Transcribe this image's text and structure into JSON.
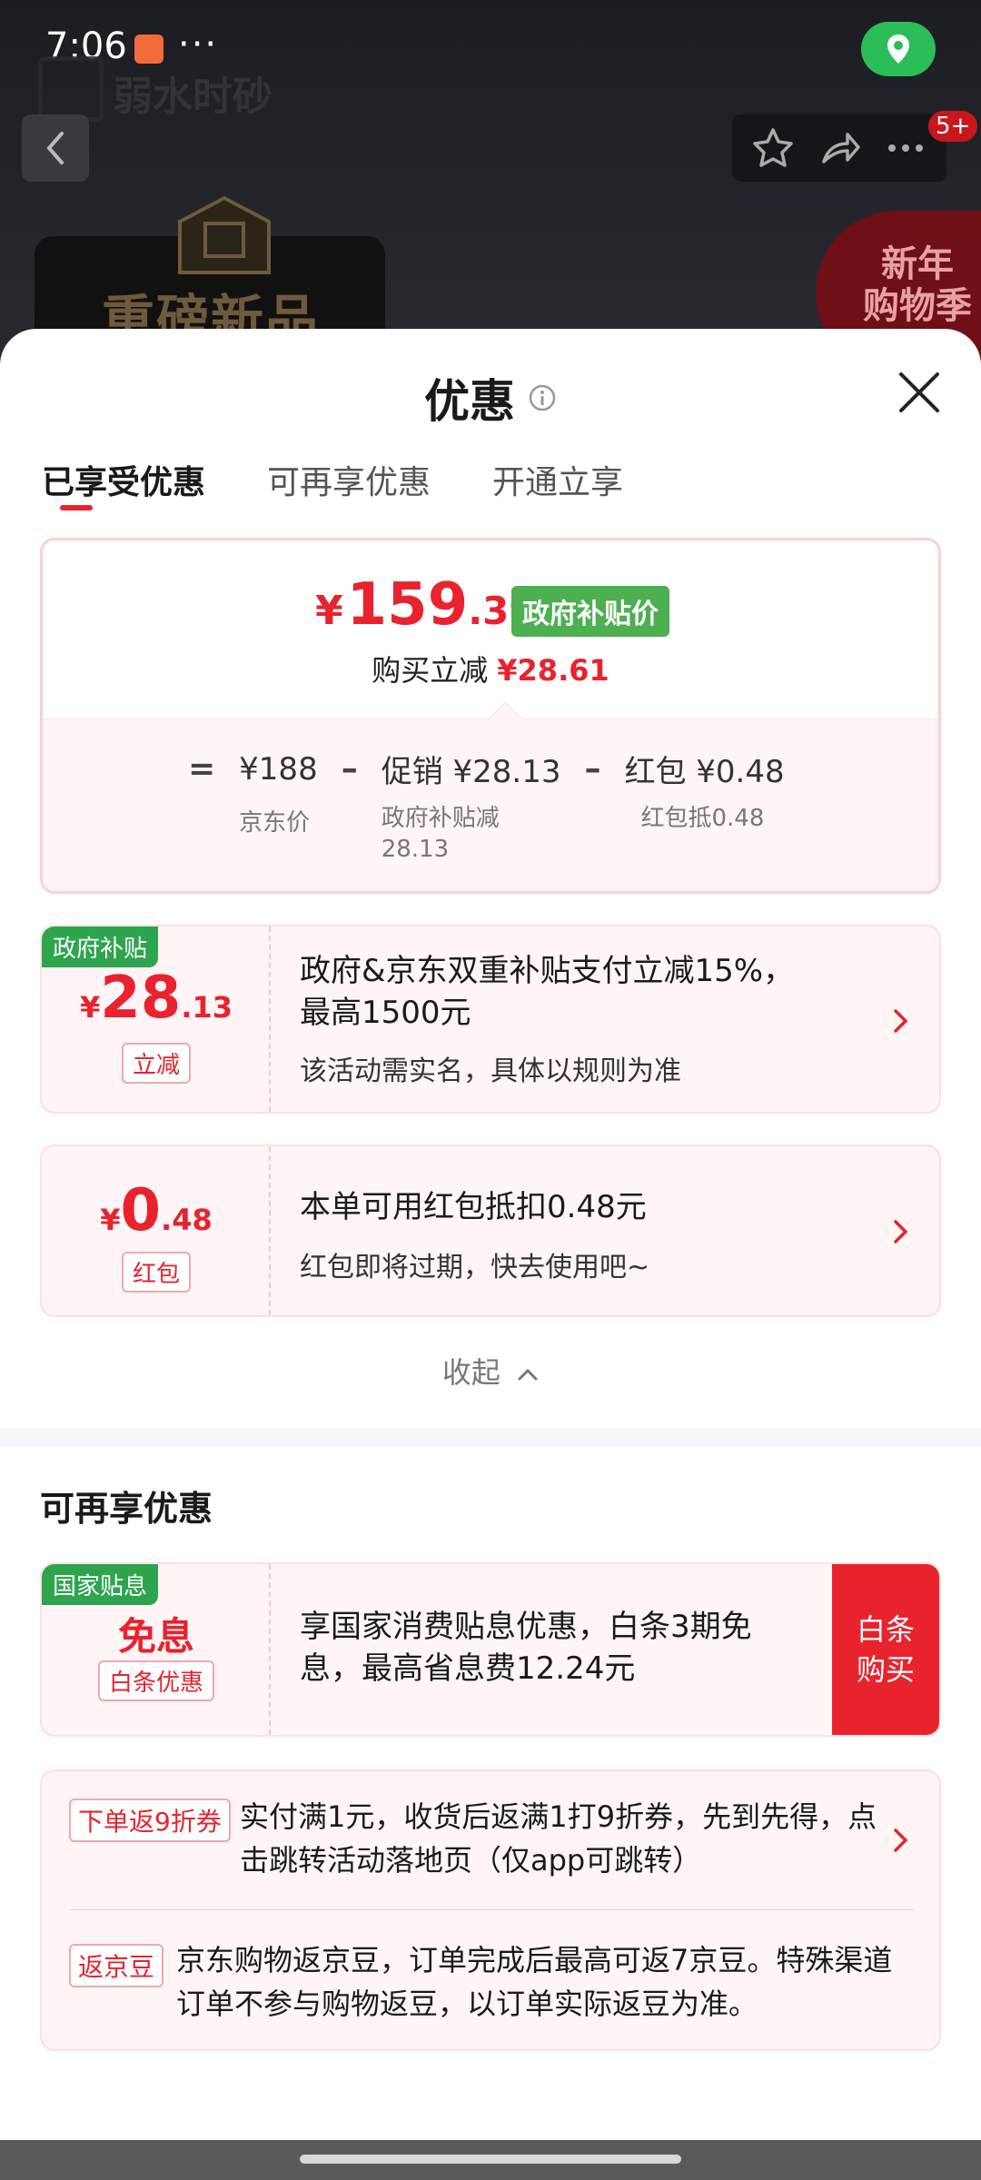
{
  "status_bar": {
    "time": "7:06",
    "dots": "···"
  },
  "background": {
    "brand_name": "弱水时砂",
    "new_product": "重磅新品",
    "season_badge_line1": "新年",
    "season_badge_line2": "购物季",
    "notification_count": "5+"
  },
  "sheet": {
    "title": "优惠",
    "tabs": [
      {
        "label": "已享受优惠"
      },
      {
        "label": "可再享优惠"
      },
      {
        "label": "开通立享"
      }
    ],
    "price": {
      "yen": "¥",
      "integer": "159",
      "decimal": ".39",
      "tag": "政府补贴价",
      "discount_label": "购买立减",
      "discount_amount": "¥28.61"
    },
    "calc": {
      "equals": "=",
      "minus": "–",
      "base_price": "¥188",
      "base_label": "京东价",
      "promo_price": "促销 ¥28.13",
      "promo_label_1": "政府补贴减",
      "promo_label_2": "28.13",
      "hongbao_price": "红包 ¥0.48",
      "hongbao_label": "红包抵0.48"
    },
    "coupons": [
      {
        "tag": "政府补贴",
        "yen": "¥",
        "integer": "28",
        "decimal": ".13",
        "label": "立减",
        "text_1": "政府&京东双重补贴支付立减15%，",
        "text_2": "最高1500元",
        "sub": "该活动需实名，具体以规则为准"
      },
      {
        "yen": "¥",
        "integer": "0",
        "decimal": ".48",
        "label": "红包",
        "text_1": "本单可用红包抵扣0.48元",
        "sub": "红包即将过期，快去使用吧~"
      }
    ],
    "collapse_label": "收起",
    "more_section": {
      "title": "可再享优惠",
      "interest_free": {
        "tag": "国家贴息",
        "headline": "免息",
        "label": "白条优惠",
        "text_1": "享国家消费贴息优惠，白条3期免",
        "text_2": "息，最高省息费12.24元",
        "button_1": "白条",
        "button_2": "购买"
      },
      "items": [
        {
          "tag": "下单返9折券",
          "text_1": "实付满1元，收货后返满1打9折券，先到先得，点",
          "text_2": "击跳转活动落地页（仅app可跳转）"
        },
        {
          "tag": "返京豆",
          "text_1": "京东购物返京豆，订单完成后最高可返7京豆。特殊渠道",
          "text_2": "订单不参与购物返豆，以订单实际返豆为准。"
        }
      ]
    }
  },
  "colors": {
    "accent_red": "#e8232e",
    "gov_green": "#4caf50",
    "tag_green": "#2ea44f"
  }
}
